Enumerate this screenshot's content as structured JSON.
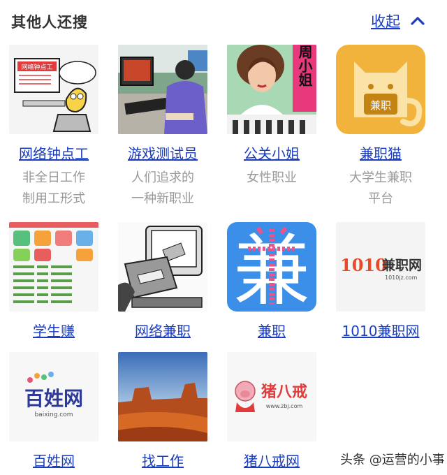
{
  "header": {
    "title": "其他人还搜",
    "collapse_label": "收起"
  },
  "items": [
    {
      "name": "网络钟点工",
      "desc1": "非全日工作",
      "desc2": "制用工形式"
    },
    {
      "name": "游戏测试员",
      "desc1": "人们追求的",
      "desc2": "一种新职业"
    },
    {
      "name": "公关小姐",
      "desc1": "女性职业",
      "desc2": ""
    },
    {
      "name": "兼职猫",
      "desc1": "大学生兼职",
      "desc2": "平台"
    },
    {
      "name": "学生赚",
      "desc1": "",
      "desc2": ""
    },
    {
      "name": "网络兼职",
      "desc1": "",
      "desc2": ""
    },
    {
      "name": "兼职",
      "desc1": "",
      "desc2": ""
    },
    {
      "name": "1010兼职网",
      "desc1": "",
      "desc2": ""
    },
    {
      "name": "百姓网",
      "desc1": "",
      "desc2": ""
    },
    {
      "name": "找工作",
      "desc1": "",
      "desc2": ""
    },
    {
      "name": "猪八戒网",
      "desc1": "",
      "desc2": ""
    }
  ],
  "thumb_text": {
    "cartoon_sign": "网络钟点工",
    "poster_text": "周小姐",
    "cat_badge": "兼职",
    "jianzhi_char": "兼",
    "logo_1010_num": "1010",
    "logo_1010_cn": "兼职网",
    "logo_1010_url": "1010jz.com",
    "baixing_cn": "百姓网",
    "baixing_url": "baixing.com",
    "zbj_cn": "猪八戒",
    "zbj_url": "www.zbj.com"
  },
  "watermark": "头条 @运营的小事",
  "colors": {
    "link": "#1a3dc1",
    "desc": "#999999",
    "title": "#333333",
    "cat_bg": "#f2b33d",
    "jianzhi_bg": "#3b8fe8",
    "jianzhi_char": "#e8548c"
  },
  "icons": {
    "collapse": "chevron-up-icon"
  }
}
